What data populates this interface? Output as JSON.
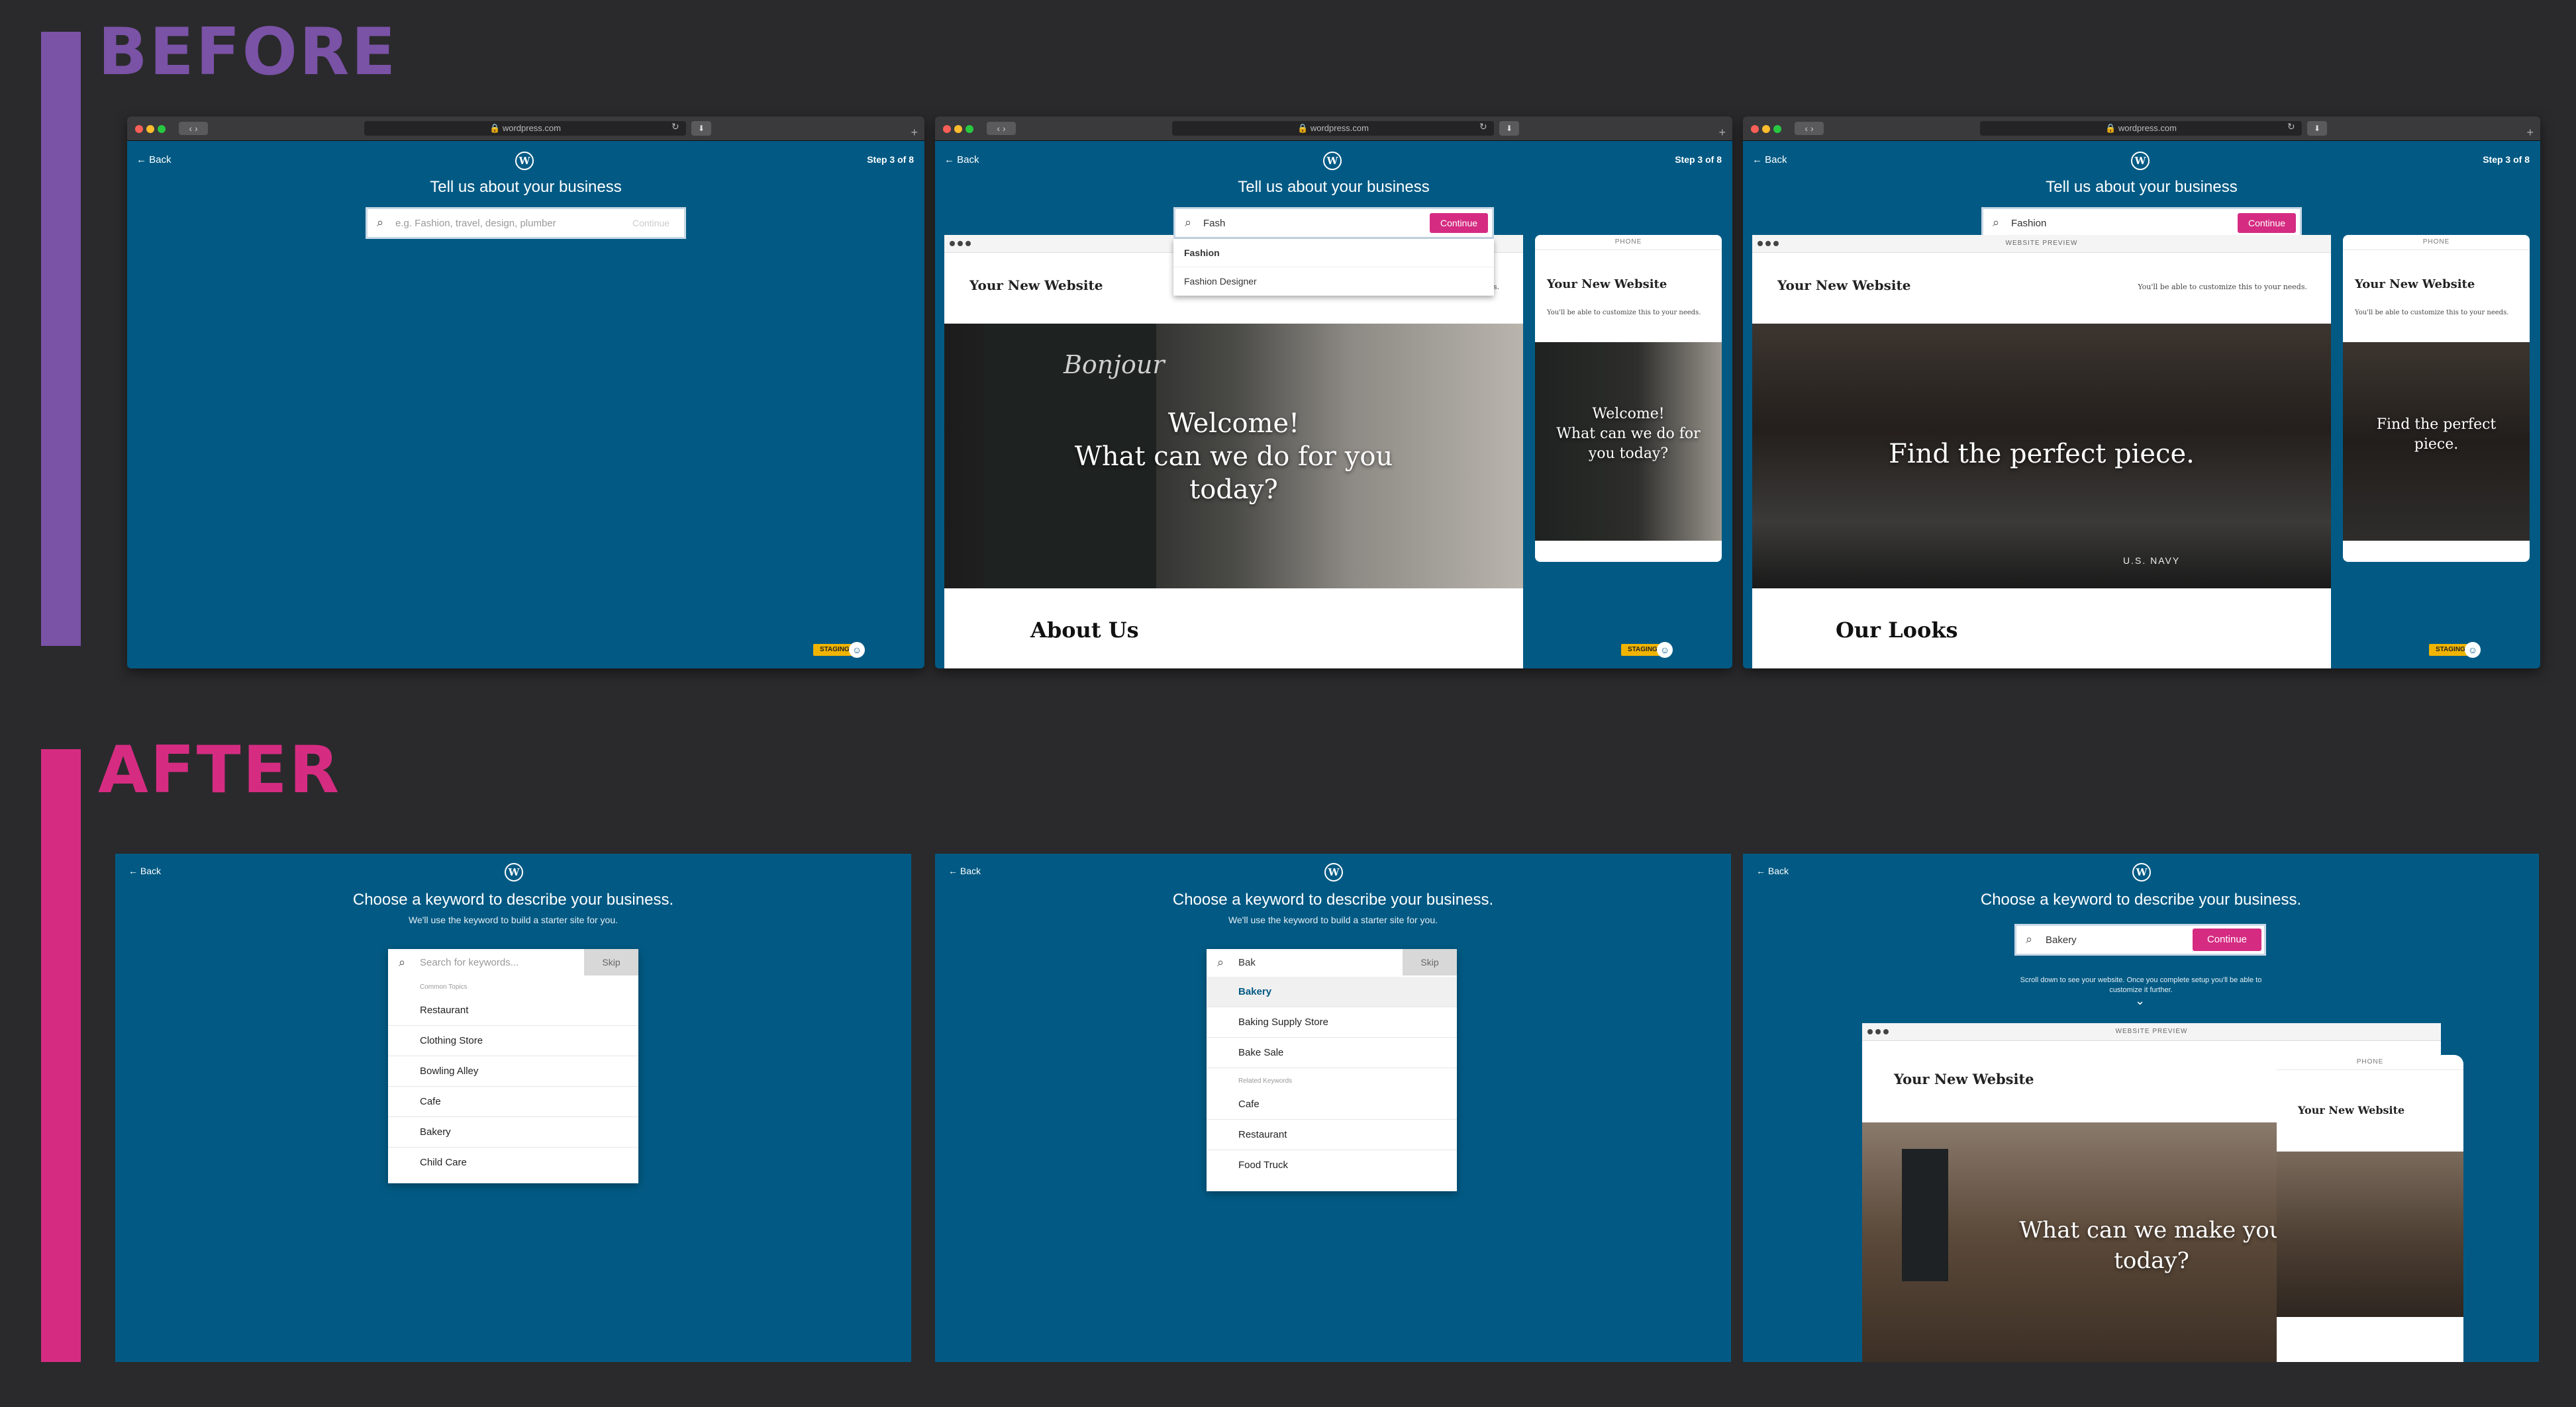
{
  "headings": {
    "before": "BEFORE",
    "after": "AFTER"
  },
  "colors": {
    "before_bar": "#7a52a6",
    "after_bar": "#d52c82",
    "panel_bg": "#025a84",
    "accent": "#d52c82",
    "background": "#2a2a2c"
  },
  "before": {
    "url": "wordpress.com",
    "back": "Back",
    "step": "Step 3 of 8",
    "title": "Tell us about your business",
    "placeholder": "e.g. Fashion, travel, design, plumber",
    "continue": "Continue",
    "staging": "STAGING",
    "query_partial": "Fash",
    "query_full": "Fashion",
    "suggestions": [
      "Fashion",
      "Fashion Designer"
    ],
    "site_title": "Your New Website",
    "customize_hint": "You'll be able to customize this to your needs.",
    "website_preview": "WEBSITE PREVIEW",
    "phone_label": "PHONE",
    "hero_welcome": "Welcome!\nWhat can we do for you today?",
    "hero_welcome_phone": "Welcome!\nWhat can we do for you today?",
    "chalkboard": "Bonjour",
    "section_about": "About Us",
    "hero_fashion": "Find the perfect piece.",
    "hero_fashion_phone": "Find the perfect piece.",
    "section_looks": "Our Looks",
    "navy_label": "U.S. NAVY"
  },
  "after": {
    "back": "Back",
    "title": "Choose a keyword to describe your business.",
    "subtitle": "We'll use the keyword to build a starter site for you.",
    "search_placeholder": "Search for keywords...",
    "skip": "Skip",
    "common_topics": "Common Topics",
    "common_items": [
      "Restaurant",
      "Clothing Store",
      "Bowling Alley",
      "Cafe",
      "Bakery",
      "Child Care"
    ],
    "query": "Bak",
    "matches": [
      "Bakery",
      "Baking Supply Store",
      "Bake Sale"
    ],
    "related_keywords": "Related Keywords",
    "related_items": [
      "Cafe",
      "Restaurant",
      "Food Truck"
    ],
    "selected": "Bakery",
    "continue": "Continue",
    "scroll_hint": "Scroll down to see your website. Once you complete setup you'll be able to customize it further.",
    "website_preview": "WEBSITE PREVIEW",
    "phone_label": "PHONE",
    "site_title": "Your New Website",
    "hero_bakery": "What can we make you today?"
  }
}
